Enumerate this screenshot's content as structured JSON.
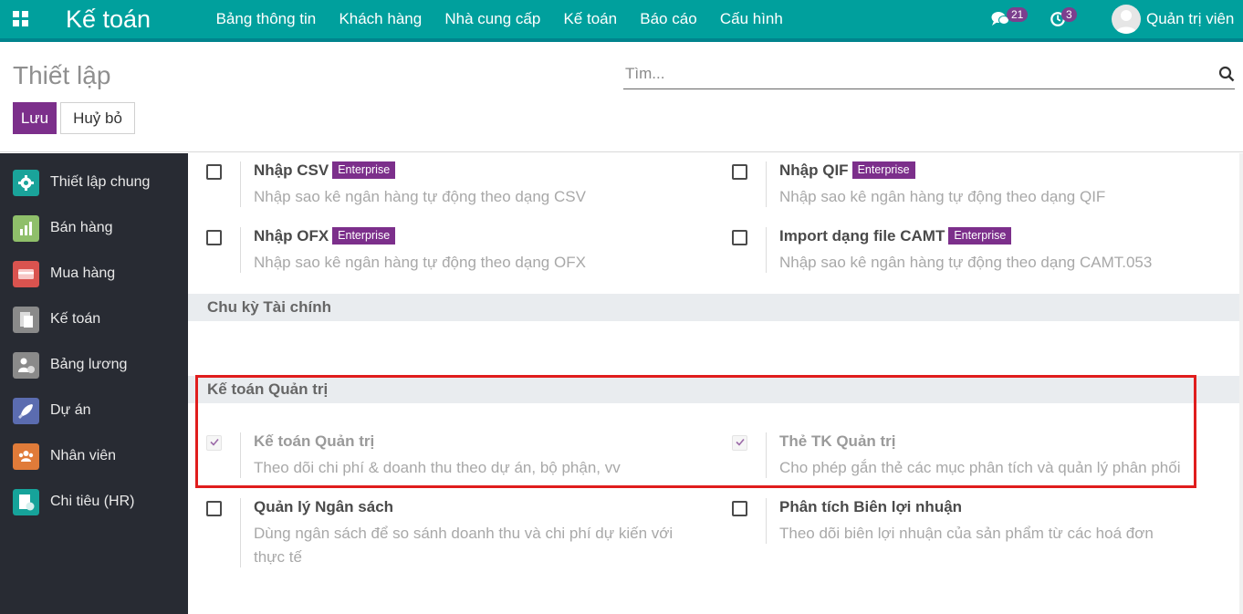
{
  "navbar": {
    "brand": "Kế toán",
    "menu": [
      "Bảng thông tin",
      "Khách hàng",
      "Nhà cung cấp",
      "Kế toán",
      "Báo cáo",
      "Cấu hình"
    ],
    "messages_count": "21",
    "activities_count": "3",
    "user_name": "Quản trị viên"
  },
  "control": {
    "title": "Thiết lập",
    "save_label": "Lưu",
    "cancel_label": "Huỷ bỏ",
    "search_placeholder": "Tìm..."
  },
  "sidebar": {
    "items": [
      {
        "label": "Thiết lập chung",
        "icon": "gear-icon",
        "color": "#1aa39a"
      },
      {
        "label": "Bán hàng",
        "icon": "sales-chart-icon",
        "color": "#8fbf6a"
      },
      {
        "label": "Mua hàng",
        "icon": "purchase-card-icon",
        "color": "#d9534f"
      },
      {
        "label": "Kế toán",
        "icon": "invoice-icon",
        "color": "#8a8a8a"
      },
      {
        "label": "Bảng lương",
        "icon": "payroll-icon",
        "color": "#8a8a8a"
      },
      {
        "label": "Dự án",
        "icon": "rocket-icon",
        "color": "#5b6cb0"
      },
      {
        "label": "Nhân viên",
        "icon": "employees-icon",
        "color": "#e07b39"
      },
      {
        "label": "Chi tiêu (HR)",
        "icon": "expense-icon",
        "color": "#16a39a"
      }
    ]
  },
  "content": {
    "enterprise_label": "Enterprise",
    "settings_top": [
      {
        "title": "Nhập CSV",
        "desc": "Nhập sao kê ngân hàng tự động theo dạng CSV",
        "enterprise": true
      },
      {
        "title": "Nhập QIF",
        "desc": "Nhập sao kê ngân hàng tự động theo dạng QIF",
        "enterprise": true
      },
      {
        "title": "Nhập OFX",
        "desc": "Nhập sao kê ngân hàng tự động theo dạng OFX",
        "enterprise": true
      },
      {
        "title": "Import dạng file CAMT",
        "desc": "Nhập sao kê ngân hàng tự động theo dạng CAMT.053",
        "enterprise": true
      }
    ],
    "section_fiscal": "Chu kỳ Tài chính",
    "section_analytic": "Kế toán Quản trị",
    "settings_analytic": [
      {
        "title": "Kế toán Quản trị",
        "desc": "Theo dõi chi phí & doanh thu theo dự án, bộ phận, vv",
        "checked": true
      },
      {
        "title": "Thẻ TK Quản trị",
        "desc": "Cho phép gắn thẻ các mục phân tích và quản lý phân phối",
        "checked": true
      },
      {
        "title": "Quản lý Ngân sách",
        "desc": "Dùng ngân sách để so sánh doanh thu và chi phí dự kiến với thực tế",
        "checked": false
      },
      {
        "title": "Phân tích Biên lợi nhuận",
        "desc": "Theo dõi biên lợi nhuận của sản phẩm từ các hoá đơn",
        "checked": false
      }
    ]
  }
}
